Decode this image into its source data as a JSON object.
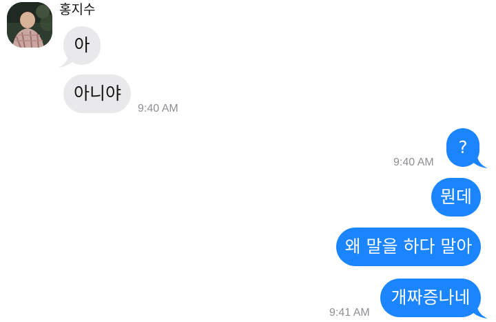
{
  "chat": {
    "sender_name": "홍지수",
    "colors": {
      "incoming_bubble": "#e9e9eb",
      "outgoing_bubble": "#1a85ff",
      "timestamp": "#8e8e93"
    },
    "messages": [
      {
        "direction": "incoming",
        "text": "아"
      },
      {
        "direction": "incoming",
        "text": "아니야",
        "time": "9:40 AM"
      },
      {
        "direction": "outgoing",
        "text": "?",
        "time": "9:40 AM"
      },
      {
        "direction": "outgoing",
        "text": "뭔데"
      },
      {
        "direction": "outgoing",
        "text": "왜 말을 하다 말아"
      },
      {
        "direction": "outgoing",
        "text": "개짜증나네",
        "time": "9:41 AM"
      }
    ]
  }
}
